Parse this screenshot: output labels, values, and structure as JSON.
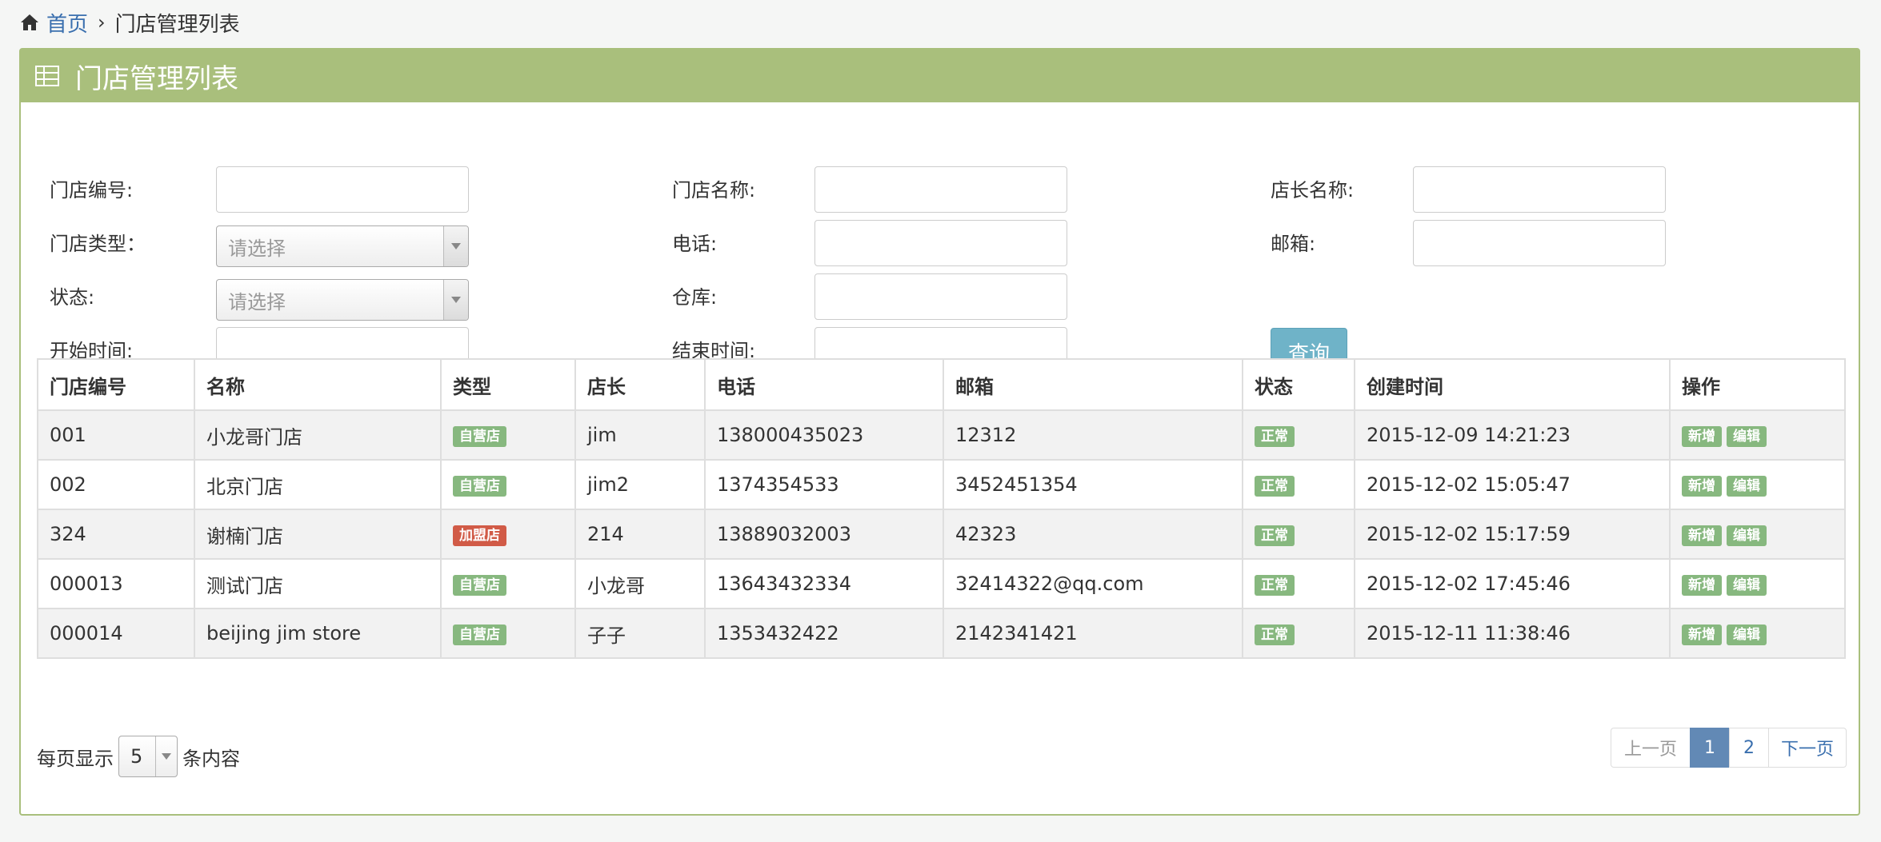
{
  "breadcrumb": {
    "home": "首页",
    "current": "门店管理列表"
  },
  "panel": {
    "title": "门店管理列表"
  },
  "filters": {
    "store_code_label": "门店编号:",
    "store_name_label": "门店名称:",
    "manager_label": "店长名称:",
    "store_type_label": "门店类型：",
    "store_type_placeholder": "请选择",
    "phone_label": "电话:",
    "email_label": "邮箱:",
    "status_label": "状态:",
    "status_placeholder": "请选择",
    "warehouse_label": "仓库:",
    "start_time_label": "开始时间:",
    "end_time_label": "结束时间:",
    "query_button": "查询"
  },
  "table": {
    "headers": [
      "门店编号",
      "名称",
      "类型",
      "店长",
      "电话",
      "邮箱",
      "状态",
      "创建时间",
      "操作"
    ],
    "rows": [
      {
        "code": "001",
        "name": "小龙哥门店",
        "type": "自营店",
        "manager": "jim",
        "phone": "138000435023",
        "email": "12312",
        "status": "正常",
        "created": "2015-12-09 14:21:23"
      },
      {
        "code": "002",
        "name": "北京门店",
        "type": "自营店",
        "manager": "jim2",
        "phone": "1374354533",
        "email": "3452451354",
        "status": "正常",
        "created": "2015-12-02 15:05:47"
      },
      {
        "code": "324",
        "name": "谢楠门店",
        "type": "加盟店",
        "manager": "214",
        "phone": "13889032003",
        "email": "42323",
        "status": "正常",
        "created": "2015-12-02 15:17:59"
      },
      {
        "code": "000013",
        "name": "测试门店",
        "type": "自营店",
        "manager": "小龙哥",
        "phone": "13643432334",
        "email": "32414322@qq.com",
        "status": "正常",
        "created": "2015-12-02 17:45:46"
      },
      {
        "code": "000014",
        "name": "beijing jim store",
        "type": "自营店",
        "manager": "子子",
        "phone": "1353432422",
        "email": "2142341421",
        "status": "正常",
        "created": "2015-12-11 11:38:46"
      }
    ],
    "action_add": "新增",
    "action_edit": "编辑"
  },
  "pagination": {
    "per_page_prefix": "每页显示",
    "per_page_value": "5",
    "per_page_suffix": "条内容",
    "prev": "上一页",
    "pages": [
      "1",
      "2"
    ],
    "next": "下一页",
    "current_page": "1"
  },
  "colors": {
    "panel_header": "#a9bf7c",
    "tag_green": "#87b87f",
    "tag_red": "#d15b47",
    "query_button": "#6fb3c8",
    "active_page": "#6289b5"
  }
}
